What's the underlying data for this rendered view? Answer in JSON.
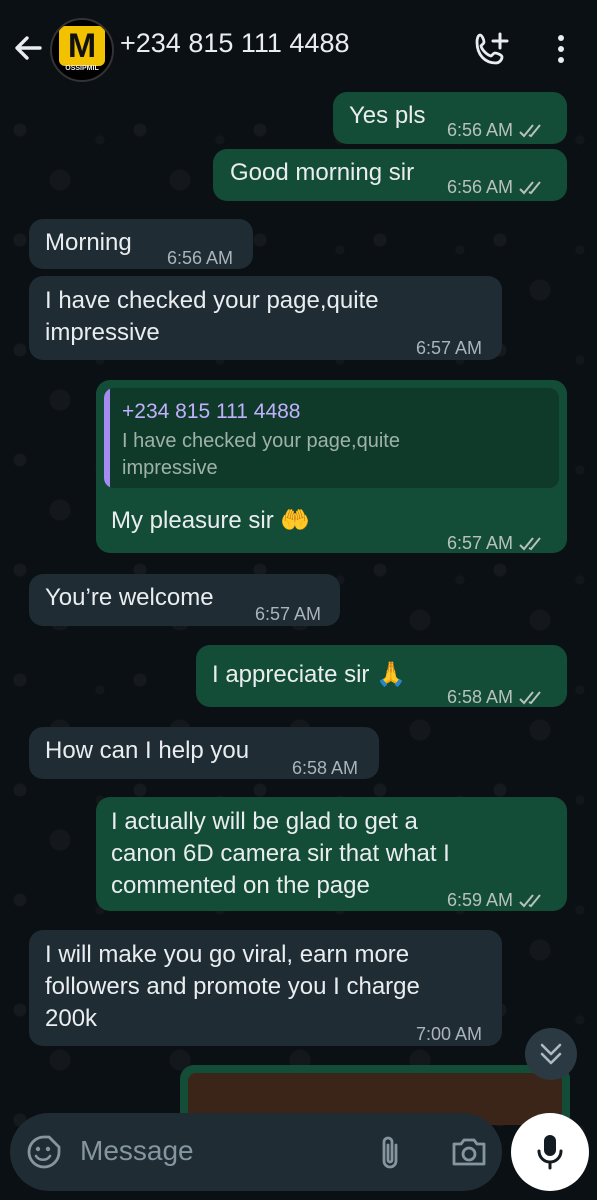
{
  "header": {
    "contact": "+234 815 111 4488",
    "avatar_letter": "M",
    "avatar_text": "OSSIPMIL"
  },
  "messages": [
    {
      "dir": "out",
      "text": "Yes pls",
      "time": "6:56 AM"
    },
    {
      "dir": "out",
      "text": "Good morning sir",
      "time": "6:56 AM"
    },
    {
      "dir": "in",
      "text": "Morning",
      "time": "6:56 AM"
    },
    {
      "dir": "in",
      "line1": "I have checked your page,quite",
      "line2": "impressive",
      "time": "6:57 AM"
    },
    {
      "dir": "out",
      "quote_name": "+234 815 111 4488",
      "quote_text": "I have checked your page,quite impressive",
      "text": "My pleasure sir 🤲",
      "time": "6:57 AM"
    },
    {
      "dir": "in",
      "text": "You’re welcome",
      "time": "6:57 AM"
    },
    {
      "dir": "out",
      "text": "I appreciate sir 🙏",
      "time": "6:58 AM"
    },
    {
      "dir": "in",
      "text": "How can I help you",
      "time": "6:58 AM"
    },
    {
      "dir": "out",
      "line1": "I actually will be glad to get a",
      "line2": "canon 6D camera sir that what I",
      "line3": "commented on the page",
      "time": "6:59 AM"
    },
    {
      "dir": "in",
      "line1": "I will make you go viral, earn more",
      "line2": "followers and promote you I charge",
      "line3": "200k",
      "time": "7:00 AM"
    }
  ],
  "input": {
    "placeholder": "Message"
  },
  "colors": {
    "outgoing": "#144d37",
    "incoming": "#1f2c33",
    "background": "#0b1014"
  },
  "icons": [
    "back-arrow-icon",
    "add-call-icon",
    "more-vert-icon",
    "sticker-icon",
    "attach-icon",
    "camera-icon",
    "mic-icon",
    "double-chevron-down-icon",
    "read-ticks-icon"
  ]
}
